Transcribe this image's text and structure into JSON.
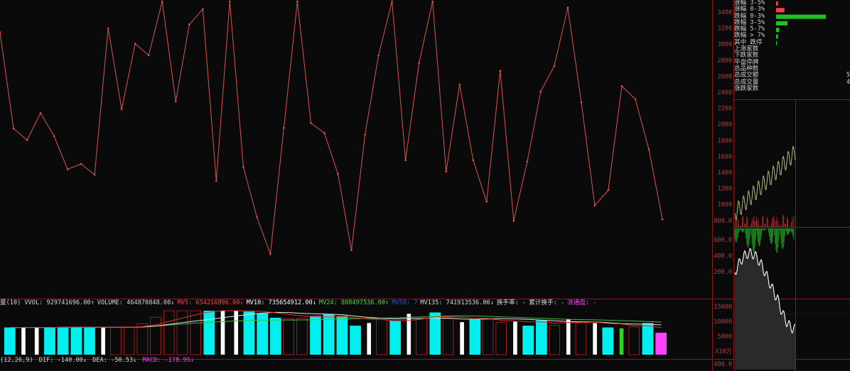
{
  "colors": {
    "background": "#0a0a0a",
    "grid_red": "#8b1a1a",
    "line_main": "#e05050",
    "cyan": "#00f0f0",
    "white": "#ffffff",
    "green": "#30d030",
    "magenta": "#ff40ff"
  },
  "chart_data": [
    {
      "type": "line",
      "title": "",
      "xlabel": "",
      "ylabel": "",
      "values": [
        3100,
        1850,
        1700,
        2050,
        1750,
        1320,
        1390,
        1250,
        3150,
        2100,
        2950,
        2800,
        3500,
        2200,
        3200,
        3400,
        1170,
        3500,
        1350,
        700,
        220,
        1860,
        3500,
        1920,
        1790,
        1260,
        270,
        1770,
        2800,
        3500,
        1440,
        2700,
        3500,
        1290,
        2420,
        1440,
        900,
        2600,
        650,
        1420,
        2330,
        2660,
        3420,
        2190,
        850,
        1050,
        2400,
        2230,
        1580,
        670
      ],
      "ylim": [
        0,
        3500
      ]
    },
    {
      "type": "bar",
      "title": "",
      "stats_line": [
        {
          "text": "量(10) VVOL: 929741696.00↑",
          "color": "#d8d8d8"
        },
        {
          "text": "VOLUME: 464870848.00↓",
          "color": "#d8d8d8"
        },
        {
          "text": "MV5: 654216896.00↓",
          "color": "#ff4040"
        },
        {
          "text": "MV10: 735654912.00↓",
          "color": "#ffffff"
        },
        {
          "text": "MV24: 808497536.00↑",
          "color": "#40e040"
        },
        {
          "text": "MV50: 7",
          "color": "#3050ff"
        },
        {
          "text": "MV135: 741913536.00↓",
          "color": "#d8d8d8"
        },
        {
          "text": "换手率: -",
          "color": "#d8d8d8"
        },
        {
          "text": "累计换手: -",
          "color": "#d8d8d8"
        },
        {
          "text": "流通盘: -",
          "color": "#ff40ff"
        }
      ],
      "values": [
        0.62,
        0.62,
        0.62,
        0.62,
        0.63,
        0.63,
        0.62,
        0.62,
        0.62,
        0.63,
        0.7,
        0.85,
        1.0,
        1.0,
        1.0,
        1.0,
        1.0,
        1.0,
        0.98,
        0.94,
        0.84,
        0.82,
        0.83,
        0.88,
        0.92,
        0.88,
        0.66,
        0.72,
        0.8,
        0.78,
        0.93,
        0.82,
        0.96,
        0.82,
        0.74,
        0.8,
        0.8,
        0.73,
        0.75,
        0.66,
        0.78,
        0.67,
        0.8,
        0.74,
        0.72,
        0.62,
        0.6,
        0.63,
        0.72,
        0.5
      ],
      "colors": [
        "cyan",
        "white",
        "white",
        "cyan",
        "cyan",
        "cyan",
        "cyan",
        "white",
        "hollow",
        "hollow",
        "hollow",
        "hollow",
        "hollow",
        "hollow",
        "hollow",
        "cyan",
        "white",
        "white",
        "cyan",
        "cyan",
        "cyan",
        "hollow",
        "hollow",
        "cyan",
        "cyan",
        "cyan",
        "cyan",
        "white",
        "hollow",
        "cyan",
        "white",
        "hollow",
        "cyan",
        "hollow",
        "white",
        "cyan",
        "hollow",
        "hollow",
        "white",
        "cyan",
        "cyan",
        "hollow",
        "white",
        "hollow",
        "white",
        "cyan",
        "green",
        "hollow",
        "cyan",
        "magenta"
      ]
    }
  ],
  "macd_line": {
    "prefix": "(12,26,9)",
    "dif": "DIF: -140.00↓",
    "dea": "DEA: -50.53↓",
    "macd": "MACD: -178.95↓"
  },
  "right_axis": {
    "price_ticks": [
      "3400",
      "3200",
      "3000",
      "2800",
      "2600",
      "2400",
      "2200",
      "2000",
      "1800",
      "1600",
      "1400",
      "1200",
      "1000",
      "800.0"
    ],
    "lower_ticks": [
      "600.0",
      "400.0",
      "200.0"
    ],
    "vol_ticks": [
      "15000",
      "10000",
      "5000",
      "X10万"
    ],
    "macd_tick": "400.0"
  },
  "stats_panel": {
    "rows": [
      {
        "label": "涨幅 3-5%",
        "bar": 0.03,
        "color": "#ff4040"
      },
      {
        "label": "涨幅 0-3%",
        "bar": 0.13,
        "color": "#ff4040"
      },
      {
        "label": "跌幅 0-3%",
        "bar": 0.78,
        "color": "#20c020"
      },
      {
        "label": "跌幅 3-5%",
        "bar": 0.18,
        "color": "#20c020"
      },
      {
        "label": "跌幅 5-7%",
        "bar": 0.05,
        "color": "#20c020"
      },
      {
        "label": "跌幅 > 7%",
        "bar": 0.03,
        "color": "#20c020"
      },
      {
        "label": "其中 跌停",
        "bar": 0.005,
        "color": "#20c020"
      }
    ],
    "summary": [
      {
        "label": "上涨家数",
        "value": ""
      },
      {
        "label": "下跌家数",
        "value": ""
      },
      {
        "label": "平盘停牌",
        "value": ""
      },
      {
        "label": "总品种数",
        "value": ""
      },
      {
        "label": "总成交额",
        "value": "5"
      },
      {
        "label": "总成交量",
        "value": "4"
      }
    ],
    "footer": "涨跌家数"
  }
}
